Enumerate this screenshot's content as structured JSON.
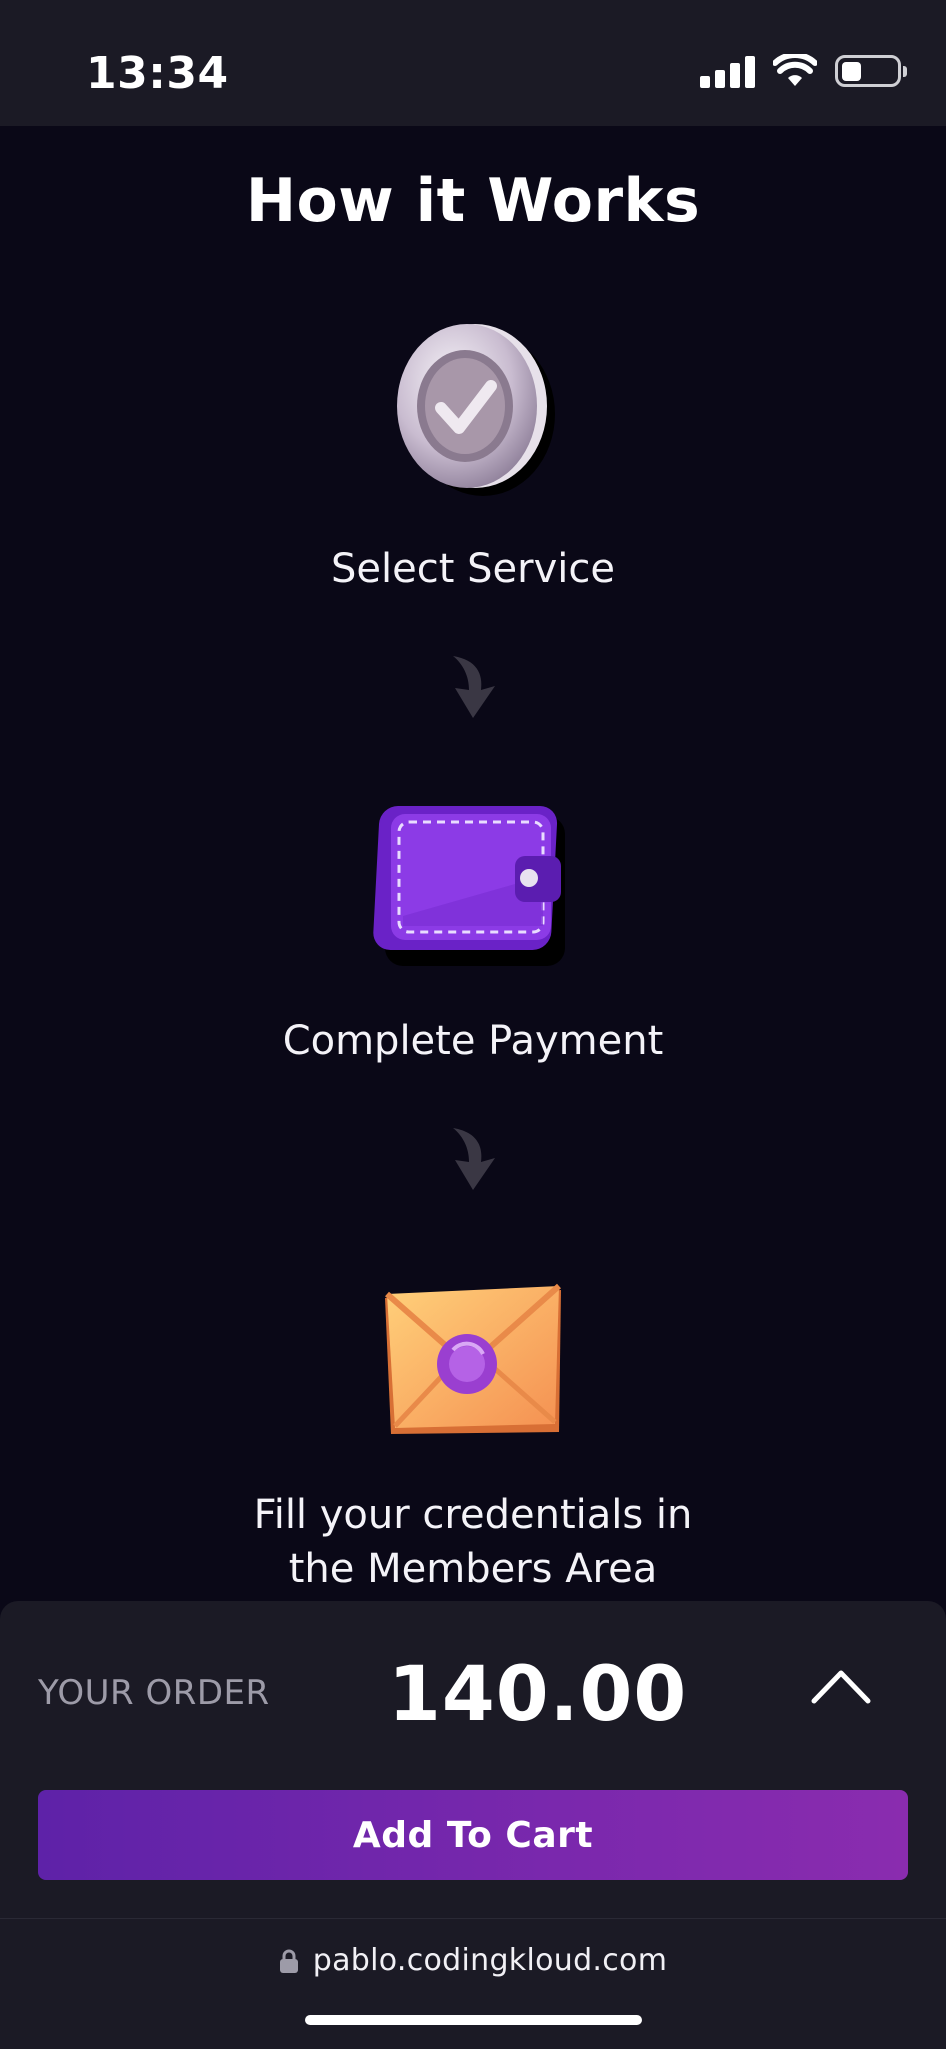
{
  "status_bar": {
    "time": "13:34",
    "icons": [
      "signal-icon",
      "wifi-icon",
      "battery-icon"
    ]
  },
  "page": {
    "heading": "How it Works",
    "steps": [
      {
        "label": "Select Service",
        "icon": "check-coin-icon"
      },
      {
        "label": "Complete Payment",
        "icon": "wallet-icon"
      },
      {
        "label_line1": "Fill your credentials in",
        "label_line2": "the Members Area",
        "icon": "envelope-icon"
      }
    ],
    "step_arrow_icon": "arrow-down-icon"
  },
  "order": {
    "label": "YOUR ORDER",
    "total": "140.00",
    "toggle_icon": "chevron-up-icon",
    "add_to_cart_label": "Add To Cart"
  },
  "browser": {
    "url": "pablo.codingkloud.com",
    "lock_icon": "lock-icon"
  },
  "colors": {
    "background": "#0a0817",
    "panel": "#1b1a25",
    "accent": "#6d25ab",
    "muted_text": "#9d9ba8"
  }
}
